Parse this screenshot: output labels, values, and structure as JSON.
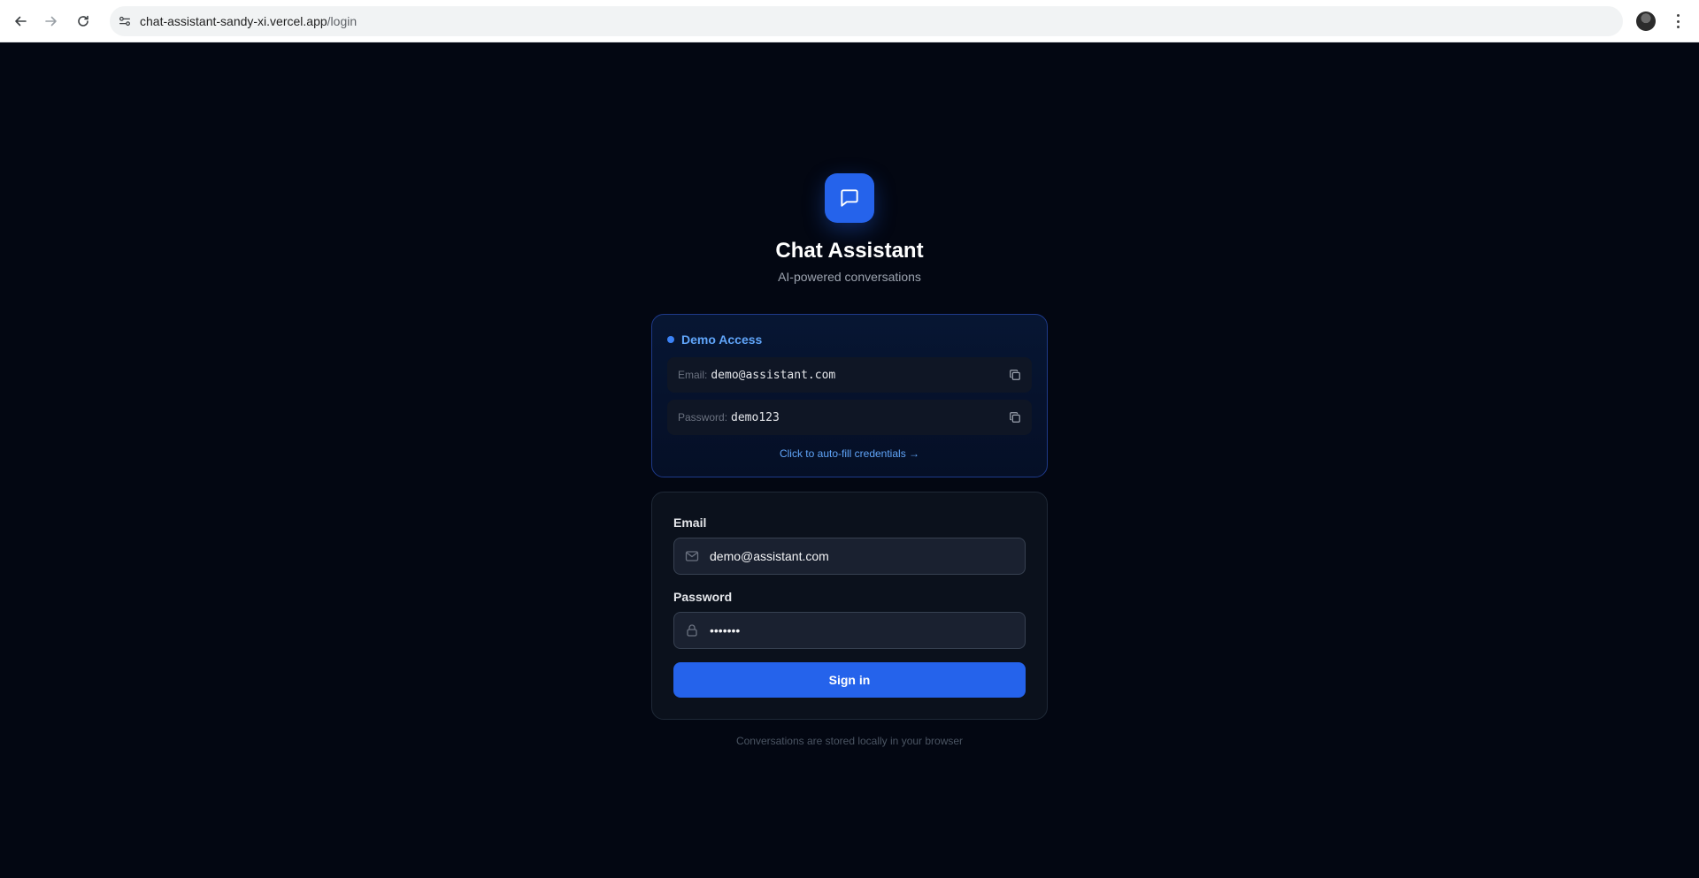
{
  "browser": {
    "url_host": "chat-assistant-sandy-xi.vercel.app",
    "url_path": "/login",
    "icons": {
      "back": "back-arrow-icon",
      "forward": "forward-arrow-icon",
      "reload": "reload-icon",
      "site_info": "site-settings-icon",
      "bookmark": "star-icon",
      "profile": "avatar",
      "menu": "kebab-menu-icon"
    }
  },
  "app": {
    "title": "Chat Assistant",
    "subtitle": "AI-powered conversations",
    "logo_icon": "chat-bubble-icon",
    "accent_color": "#2563eb"
  },
  "demo": {
    "heading": "Demo Access",
    "email_label": "Email:",
    "email_value": "demo@assistant.com",
    "password_label": "Password:",
    "password_value": "demo123",
    "autofill_text": "Click to auto-fill credentials →",
    "copy_icon": "copy-icon"
  },
  "form": {
    "email_label": "Email",
    "email_value": "demo@assistant.com",
    "email_icon": "mail-icon",
    "password_label": "Password",
    "password_value": "demo123",
    "password_icon": "lock-icon",
    "submit_label": "Sign in"
  },
  "footer": {
    "note": "Conversations are stored locally in your browser"
  }
}
